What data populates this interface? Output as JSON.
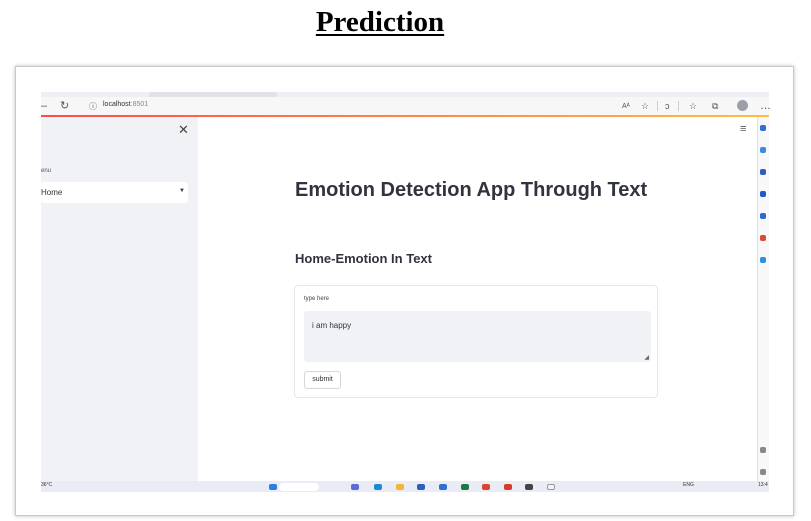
{
  "document": {
    "title": "Prediction"
  },
  "browser": {
    "url_host": "localhost",
    "url_port": ":8501"
  },
  "sidebar": {
    "menu_label": "enu",
    "selected": "Home"
  },
  "main": {
    "title": "Emotion Detection App Through Text",
    "subtitle": "Home-Emotion In Text",
    "form": {
      "label": "type here",
      "text_value": "i am happy",
      "submit_label": "submit"
    }
  },
  "taskbar": {
    "weather": "36°C",
    "lang": "ENG",
    "time": "13:4"
  },
  "colors": {
    "accent_start": "#ff4b4b",
    "accent_end": "#ffbd45",
    "sidebar_bg": "#f0f2f6",
    "text_dark": "#31333f"
  }
}
